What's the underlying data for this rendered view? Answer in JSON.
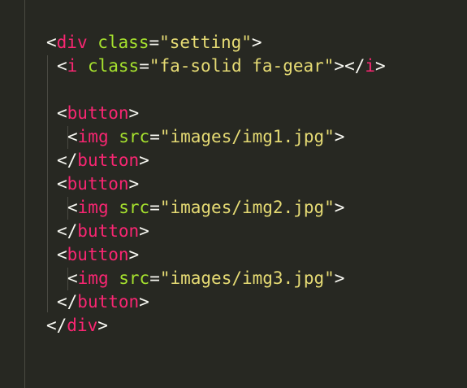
{
  "editor": {
    "colors": {
      "background": "#272822",
      "punctuation": "#f8f8f2",
      "tag": "#f92672",
      "attribute": "#a6e22e",
      "string": "#e6db74",
      "indent_guide": "#4a4a42"
    },
    "lines": [
      {
        "indent": 0,
        "tokens": [
          {
            "text": "<",
            "kind": "punctuation"
          },
          {
            "text": "div",
            "kind": "tag"
          },
          {
            "text": " ",
            "kind": "punctuation"
          },
          {
            "text": "class",
            "kind": "attribute"
          },
          {
            "text": "=",
            "kind": "punctuation"
          },
          {
            "text": "\"setting\"",
            "kind": "string"
          },
          {
            "text": ">",
            "kind": "punctuation"
          }
        ]
      },
      {
        "indent": 1,
        "tokens": [
          {
            "text": "<",
            "kind": "punctuation"
          },
          {
            "text": "i",
            "kind": "tag"
          },
          {
            "text": " ",
            "kind": "punctuation"
          },
          {
            "text": "class",
            "kind": "attribute"
          },
          {
            "text": "=",
            "kind": "punctuation"
          },
          {
            "text": "\"fa-solid fa-gear\"",
            "kind": "string"
          },
          {
            "text": "></",
            "kind": "punctuation"
          },
          {
            "text": "i",
            "kind": "tag"
          },
          {
            "text": ">",
            "kind": "punctuation"
          }
        ]
      },
      {
        "indent": 0,
        "tokens": []
      },
      {
        "indent": 1,
        "tokens": [
          {
            "text": "<",
            "kind": "punctuation"
          },
          {
            "text": "button",
            "kind": "tag"
          },
          {
            "text": ">",
            "kind": "punctuation"
          }
        ]
      },
      {
        "indent": 2,
        "tokens": [
          {
            "text": "<",
            "kind": "punctuation"
          },
          {
            "text": "img",
            "kind": "tag"
          },
          {
            "text": " ",
            "kind": "punctuation"
          },
          {
            "text": "src",
            "kind": "attribute"
          },
          {
            "text": "=",
            "kind": "punctuation"
          },
          {
            "text": "\"images/img1.jpg\"",
            "kind": "string"
          },
          {
            "text": ">",
            "kind": "punctuation"
          }
        ]
      },
      {
        "indent": 1,
        "tokens": [
          {
            "text": "</",
            "kind": "punctuation"
          },
          {
            "text": "button",
            "kind": "tag"
          },
          {
            "text": ">",
            "kind": "punctuation"
          }
        ]
      },
      {
        "indent": 1,
        "tokens": [
          {
            "text": "<",
            "kind": "punctuation"
          },
          {
            "text": "button",
            "kind": "tag"
          },
          {
            "text": ">",
            "kind": "punctuation"
          }
        ]
      },
      {
        "indent": 2,
        "tokens": [
          {
            "text": "<",
            "kind": "punctuation"
          },
          {
            "text": "img",
            "kind": "tag"
          },
          {
            "text": " ",
            "kind": "punctuation"
          },
          {
            "text": "src",
            "kind": "attribute"
          },
          {
            "text": "=",
            "kind": "punctuation"
          },
          {
            "text": "\"images/img2.jpg\"",
            "kind": "string"
          },
          {
            "text": ">",
            "kind": "punctuation"
          }
        ]
      },
      {
        "indent": 1,
        "tokens": [
          {
            "text": "</",
            "kind": "punctuation"
          },
          {
            "text": "button",
            "kind": "tag"
          },
          {
            "text": ">",
            "kind": "punctuation"
          }
        ]
      },
      {
        "indent": 1,
        "tokens": [
          {
            "text": "<",
            "kind": "punctuation"
          },
          {
            "text": "button",
            "kind": "tag"
          },
          {
            "text": ">",
            "kind": "punctuation"
          }
        ]
      },
      {
        "indent": 2,
        "tokens": [
          {
            "text": "<",
            "kind": "punctuation"
          },
          {
            "text": "img",
            "kind": "tag"
          },
          {
            "text": " ",
            "kind": "punctuation"
          },
          {
            "text": "src",
            "kind": "attribute"
          },
          {
            "text": "=",
            "kind": "punctuation"
          },
          {
            "text": "\"images/img3.jpg\"",
            "kind": "string"
          },
          {
            "text": ">",
            "kind": "punctuation"
          }
        ]
      },
      {
        "indent": 1,
        "tokens": [
          {
            "text": "</",
            "kind": "punctuation"
          },
          {
            "text": "button",
            "kind": "tag"
          },
          {
            "text": ">",
            "kind": "punctuation"
          }
        ]
      },
      {
        "indent": 0,
        "tokens": [
          {
            "text": "</",
            "kind": "punctuation"
          },
          {
            "text": "div",
            "kind": "tag"
          },
          {
            "text": ">",
            "kind": "punctuation"
          }
        ]
      }
    ]
  }
}
